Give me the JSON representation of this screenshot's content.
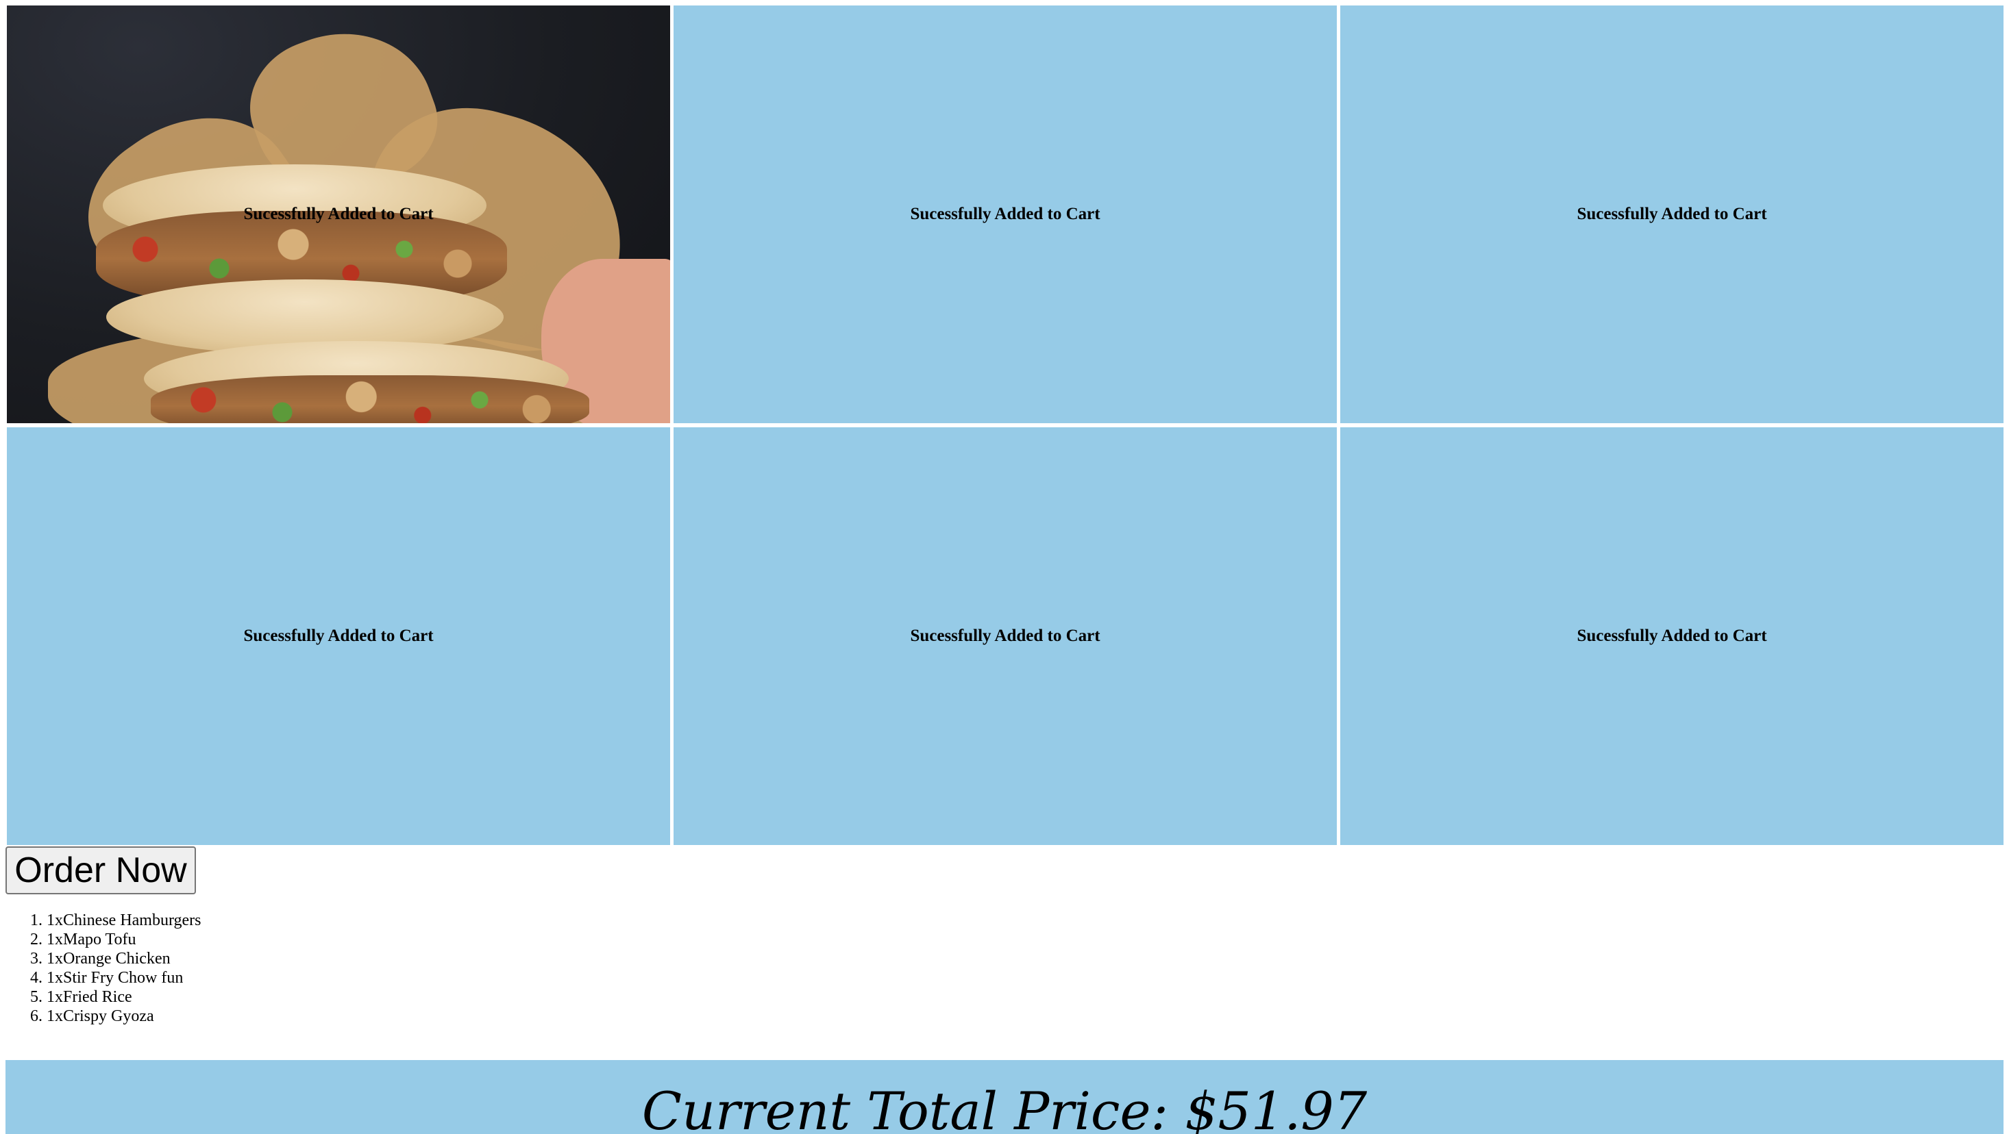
{
  "menu": {
    "tiles": [
      {
        "status_label": "Sucessfully Added to Cart",
        "has_photo": true
      },
      {
        "status_label": "Sucessfully Added to Cart",
        "has_photo": false
      },
      {
        "status_label": "Sucessfully Added to Cart",
        "has_photo": false
      },
      {
        "status_label": "Sucessfully Added to Cart",
        "has_photo": false
      },
      {
        "status_label": "Sucessfully Added to Cart",
        "has_photo": false
      },
      {
        "status_label": "Sucessfully Added to Cart",
        "has_photo": false
      }
    ],
    "tile_color": "#96cbe7"
  },
  "order_button": {
    "label": "Order Now"
  },
  "cart": {
    "items": [
      "1xChinese Hamburgers",
      "1xMapo Tofu",
      "1xOrange Chicken",
      "1xStir Fry Chow fun",
      "1xFried Rice",
      "1xCrispy Gyoza"
    ]
  },
  "total": {
    "text": "Current Total Price: $51.97"
  },
  "colors": {
    "accent": "#96cbe7",
    "background": "#ffffff"
  }
}
